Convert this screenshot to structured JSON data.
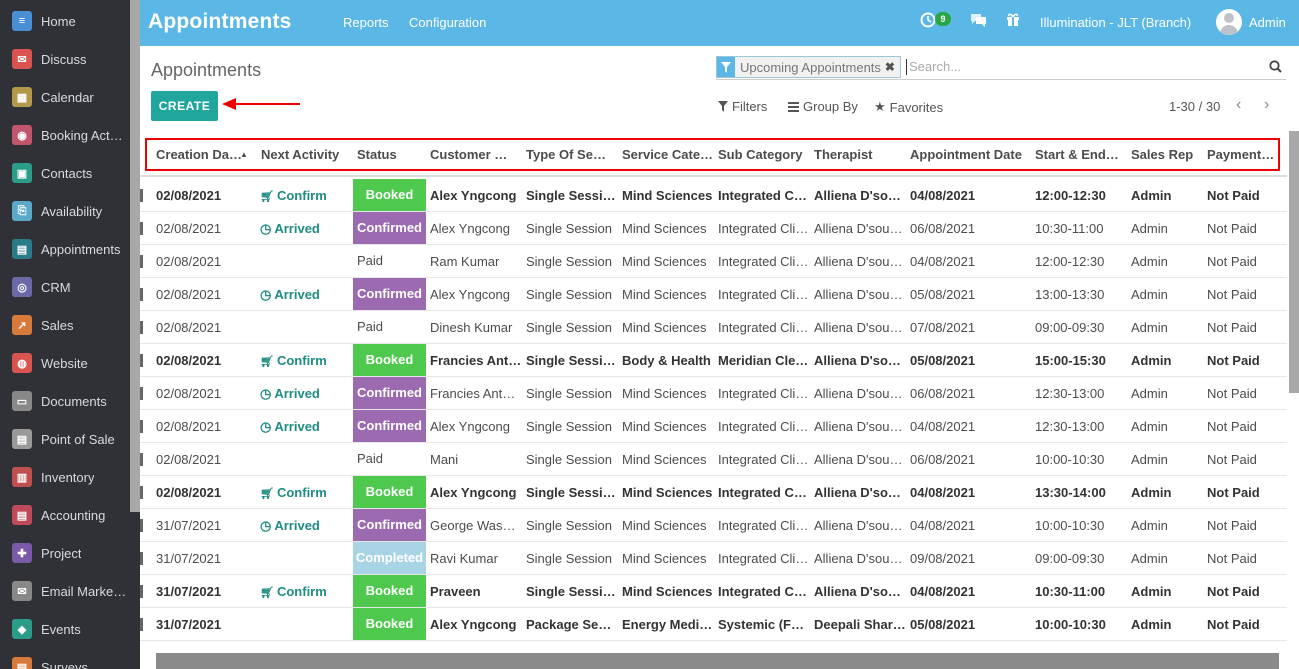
{
  "sidebar": {
    "items": [
      {
        "label": "Home",
        "icon": "home-icon",
        "color": "#4a8fd4"
      },
      {
        "label": "Discuss",
        "icon": "discuss-icon",
        "color": "#d9534f"
      },
      {
        "label": "Calendar",
        "icon": "calendar-icon",
        "color": "#b39a4a"
      },
      {
        "label": "Booking Act…",
        "icon": "booking-icon",
        "color": "#c0556b"
      },
      {
        "label": "Contacts",
        "icon": "contacts-icon",
        "color": "#2b9b8a"
      },
      {
        "label": "Availability",
        "icon": "availability-icon",
        "color": "#5aa9c9"
      },
      {
        "label": "Appointments",
        "icon": "appointments-icon",
        "color": "#2b7a8a"
      },
      {
        "label": "CRM",
        "icon": "crm-icon",
        "color": "#6a6aa8"
      },
      {
        "label": "Sales",
        "icon": "sales-icon",
        "color": "#d87a3a"
      },
      {
        "label": "Website",
        "icon": "website-icon",
        "color": "#d9534f"
      },
      {
        "label": "Documents",
        "icon": "documents-icon",
        "color": "#888888"
      },
      {
        "label": "Point of Sale",
        "icon": "pos-icon",
        "color": "#999999"
      },
      {
        "label": "Inventory",
        "icon": "inventory-icon",
        "color": "#c05050"
      },
      {
        "label": "Accounting",
        "icon": "accounting-icon",
        "color": "#c04a5a"
      },
      {
        "label": "Project",
        "icon": "project-icon",
        "color": "#7a5aa8"
      },
      {
        "label": "Email Marke…",
        "icon": "email-icon",
        "color": "#888888"
      },
      {
        "label": "Events",
        "icon": "events-icon",
        "color": "#2b9b8a"
      },
      {
        "label": "Surveys",
        "icon": "surveys-icon",
        "color": "#d87a3a"
      }
    ]
  },
  "navbar": {
    "title": "Appointments",
    "links": [
      "Reports",
      "Configuration"
    ],
    "badge": "9",
    "company": "Illumination - JLT (Branch)",
    "user": "Admin"
  },
  "control": {
    "breadcrumb": "Appointments",
    "create_label": "CREATE",
    "facet": "Upcoming Appointments",
    "search_placeholder": "Search...",
    "filters": "Filters",
    "group_by": "Group By",
    "favorites": "Favorites",
    "pager": "1-30 / 30"
  },
  "table": {
    "headers": [
      "Creation Da…",
      "Next Activity",
      "Status",
      "Customer …",
      "Type Of Se…",
      "Service Cate…",
      "Sub Category",
      "Therapist",
      "Appointment Date",
      "Start & End…",
      "Sales Rep",
      "Payment…"
    ],
    "rows": [
      {
        "bold": true,
        "created": "02/08/2021",
        "activity": "Confirm",
        "activity_icon": "cart-icon",
        "status": "Booked",
        "status_color": "#4ec94e",
        "customer": "Alex Yngcong",
        "type": "Single Session",
        "category": "Mind Sciences",
        "sub": "Integrated Cl…",
        "therapist": "Alliena D'sou…",
        "date": "04/08/2021",
        "time": "12:00-12:30",
        "rep": "Admin",
        "payment": "Not Paid"
      },
      {
        "bold": false,
        "created": "02/08/2021",
        "activity": "Arrived",
        "activity_icon": "clock-icon",
        "status": "Confirmed",
        "status_color": "#9b6ab0",
        "customer": "Alex Yngcong",
        "type": "Single Session",
        "category": "Mind Sciences",
        "sub": "Integrated Cli…",
        "therapist": "Alliena D'sou…",
        "date": "06/08/2021",
        "time": "10:30-11:00",
        "rep": "Admin",
        "payment": "Not Paid"
      },
      {
        "bold": false,
        "created": "02/08/2021",
        "activity": "",
        "activity_icon": "",
        "status": "Paid",
        "status_color": "",
        "customer": "Ram Kumar",
        "type": "Single Session",
        "category": "Mind Sciences",
        "sub": "Integrated Cli…",
        "therapist": "Alliena D'sou…",
        "date": "04/08/2021",
        "time": "12:00-12:30",
        "rep": "Admin",
        "payment": "Not Paid"
      },
      {
        "bold": false,
        "created": "02/08/2021",
        "activity": "Arrived",
        "activity_icon": "clock-icon",
        "status": "Confirmed",
        "status_color": "#9b6ab0",
        "customer": "Alex Yngcong",
        "type": "Single Session",
        "category": "Mind Sciences",
        "sub": "Integrated Cli…",
        "therapist": "Alliena D'sou…",
        "date": "05/08/2021",
        "time": "13:00-13:30",
        "rep": "Admin",
        "payment": "Not Paid"
      },
      {
        "bold": false,
        "created": "02/08/2021",
        "activity": "",
        "activity_icon": "",
        "status": "Paid",
        "status_color": "",
        "customer": "Dinesh Kumar",
        "type": "Single Session",
        "category": "Mind Sciences",
        "sub": "Integrated Cli…",
        "therapist": "Alliena D'sou…",
        "date": "07/08/2021",
        "time": "09:00-09:30",
        "rep": "Admin",
        "payment": "Not Paid"
      },
      {
        "bold": true,
        "created": "02/08/2021",
        "activity": "Confirm",
        "activity_icon": "cart-icon",
        "status": "Booked",
        "status_color": "#4ec94e",
        "customer": "Francies Ant…",
        "type": "Single Session",
        "category": "Body & Health",
        "sub": "Meridian Cle…",
        "therapist": "Alliena D'sou…",
        "date": "05/08/2021",
        "time": "15:00-15:30",
        "rep": "Admin",
        "payment": "Not Paid"
      },
      {
        "bold": false,
        "created": "02/08/2021",
        "activity": "Arrived",
        "activity_icon": "clock-icon",
        "status": "Confirmed",
        "status_color": "#9b6ab0",
        "customer": "Francies Ant…",
        "type": "Single Session",
        "category": "Mind Sciences",
        "sub": "Integrated Cli…",
        "therapist": "Alliena D'sou…",
        "date": "06/08/2021",
        "time": "12:30-13:00",
        "rep": "Admin",
        "payment": "Not Paid"
      },
      {
        "bold": false,
        "created": "02/08/2021",
        "activity": "Arrived",
        "activity_icon": "clock-icon",
        "status": "Confirmed",
        "status_color": "#9b6ab0",
        "customer": "Alex Yngcong",
        "type": "Single Session",
        "category": "Mind Sciences",
        "sub": "Integrated Cli…",
        "therapist": "Alliena D'sou…",
        "date": "04/08/2021",
        "time": "12:30-13:00",
        "rep": "Admin",
        "payment": "Not Paid"
      },
      {
        "bold": false,
        "created": "02/08/2021",
        "activity": "",
        "activity_icon": "",
        "status": "Paid",
        "status_color": "",
        "customer": "Mani",
        "type": "Single Session",
        "category": "Mind Sciences",
        "sub": "Integrated Cli…",
        "therapist": "Alliena D'sou…",
        "date": "06/08/2021",
        "time": "10:00-10:30",
        "rep": "Admin",
        "payment": "Not Paid"
      },
      {
        "bold": true,
        "created": "02/08/2021",
        "activity": "Confirm",
        "activity_icon": "cart-icon",
        "status": "Booked",
        "status_color": "#4ec94e",
        "customer": "Alex Yngcong",
        "type": "Single Session",
        "category": "Mind Sciences",
        "sub": "Integrated Cl…",
        "therapist": "Alliena D'sou…",
        "date": "04/08/2021",
        "time": "13:30-14:00",
        "rep": "Admin",
        "payment": "Not Paid"
      },
      {
        "bold": false,
        "created": "31/07/2021",
        "activity": "Arrived",
        "activity_icon": "clock-icon",
        "status": "Confirmed",
        "status_color": "#9b6ab0",
        "customer": "George Wash…",
        "type": "Single Session",
        "category": "Mind Sciences",
        "sub": "Integrated Cli…",
        "therapist": "Alliena D'sou…",
        "date": "04/08/2021",
        "time": "10:00-10:30",
        "rep": "Admin",
        "payment": "Not Paid"
      },
      {
        "bold": false,
        "created": "31/07/2021",
        "activity": "",
        "activity_icon": "",
        "status": "Completed",
        "status_color": "#a8d4e6",
        "customer": "Ravi Kumar",
        "type": "Single Session",
        "category": "Mind Sciences",
        "sub": "Integrated Cli…",
        "therapist": "Alliena D'sou…",
        "date": "09/08/2021",
        "time": "09:00-09:30",
        "rep": "Admin",
        "payment": "Not Paid"
      },
      {
        "bold": true,
        "created": "31/07/2021",
        "activity": "Confirm",
        "activity_icon": "cart-icon",
        "status": "Booked",
        "status_color": "#4ec94e",
        "customer": "Praveen",
        "type": "Single Session",
        "category": "Mind Sciences",
        "sub": "Integrated Cl…",
        "therapist": "Alliena D'sou…",
        "date": "04/08/2021",
        "time": "10:30-11:00",
        "rep": "Admin",
        "payment": "Not Paid"
      },
      {
        "bold": true,
        "created": "31/07/2021",
        "activity": "",
        "activity_icon": "",
        "status": "Booked",
        "status_color": "#4ec94e",
        "customer": "Alex Yngcong",
        "type": "Package Ses…",
        "category": "Energy Medi…",
        "sub": "Systemic (Fa…",
        "therapist": "Deepali Shar…",
        "date": "05/08/2021",
        "time": "10:00-10:30",
        "rep": "Admin",
        "payment": "Not Paid"
      }
    ]
  }
}
